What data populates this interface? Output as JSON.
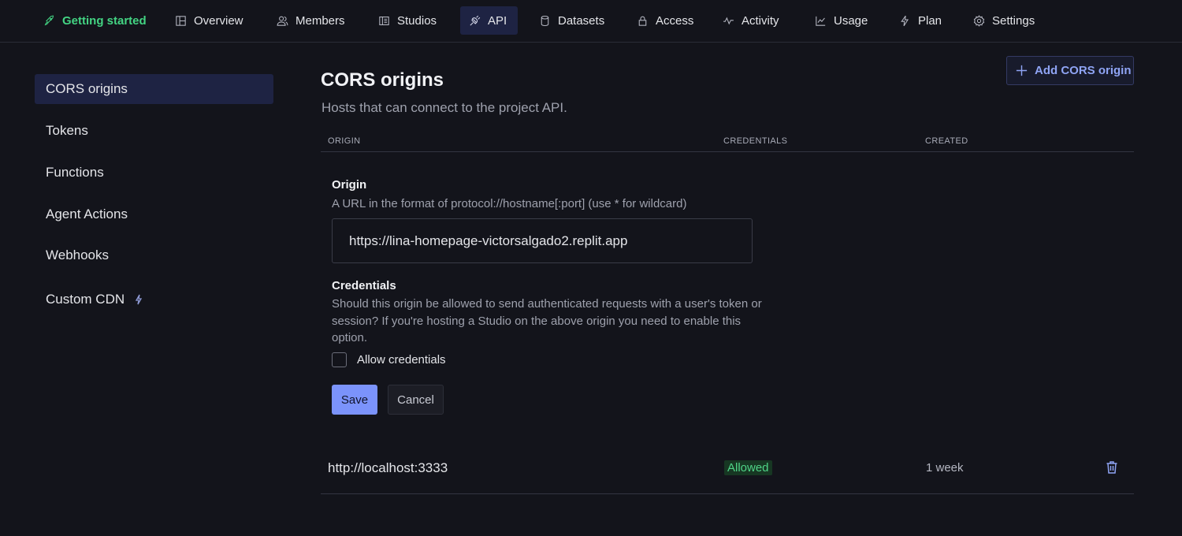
{
  "nav": {
    "items": [
      {
        "label": "Getting started",
        "icon": "rocket-icon"
      },
      {
        "label": "Overview",
        "icon": "dashboard-icon"
      },
      {
        "label": "Members",
        "icon": "users-icon"
      },
      {
        "label": "Studios",
        "icon": "studio-icon"
      },
      {
        "label": "API",
        "icon": "plug-icon"
      },
      {
        "label": "Datasets",
        "icon": "database-icon"
      },
      {
        "label": "Access",
        "icon": "lock-icon"
      },
      {
        "label": "Activity",
        "icon": "activity-icon"
      },
      {
        "label": "Usage",
        "icon": "chart-icon"
      },
      {
        "label": "Plan",
        "icon": "bolt-icon"
      },
      {
        "label": "Settings",
        "icon": "gear-icon"
      }
    ],
    "active": "API",
    "highlight_color": "#43d483"
  },
  "sidebar": {
    "items": [
      {
        "label": "CORS origins"
      },
      {
        "label": "Tokens"
      },
      {
        "label": "Functions"
      },
      {
        "label": "Agent Actions"
      },
      {
        "label": "Webhooks"
      },
      {
        "label": "Custom CDN",
        "icon": "bolt-icon"
      }
    ],
    "active": "CORS origins"
  },
  "main": {
    "title": "CORS origins",
    "subtitle": "Hosts that can connect to the project API.",
    "add_button": "Add CORS origin",
    "columns": {
      "origin": "ORIGIN",
      "credentials": "CREDENTIALS",
      "created": "CREATED"
    },
    "form": {
      "origin_label": "Origin",
      "origin_desc": "A URL in the format of protocol://hostname[:port] (use * for wildcard)",
      "origin_value": "https://lina-homepage-victorsalgado2.replit.app",
      "credentials_label": "Credentials",
      "credentials_desc_1": "Should this origin be allowed to send authenticated requests with a user's token or",
      "credentials_desc_2": "session? If you're hosting a Studio on the above origin you need to enable this",
      "credentials_desc_3": "option.",
      "allow_label": "Allow credentials",
      "allow_checked": false,
      "save": "Save",
      "cancel": "Cancel"
    },
    "rows": [
      {
        "origin": "http://localhost:3333",
        "credentials": "Allowed",
        "created": "1 week"
      }
    ]
  }
}
